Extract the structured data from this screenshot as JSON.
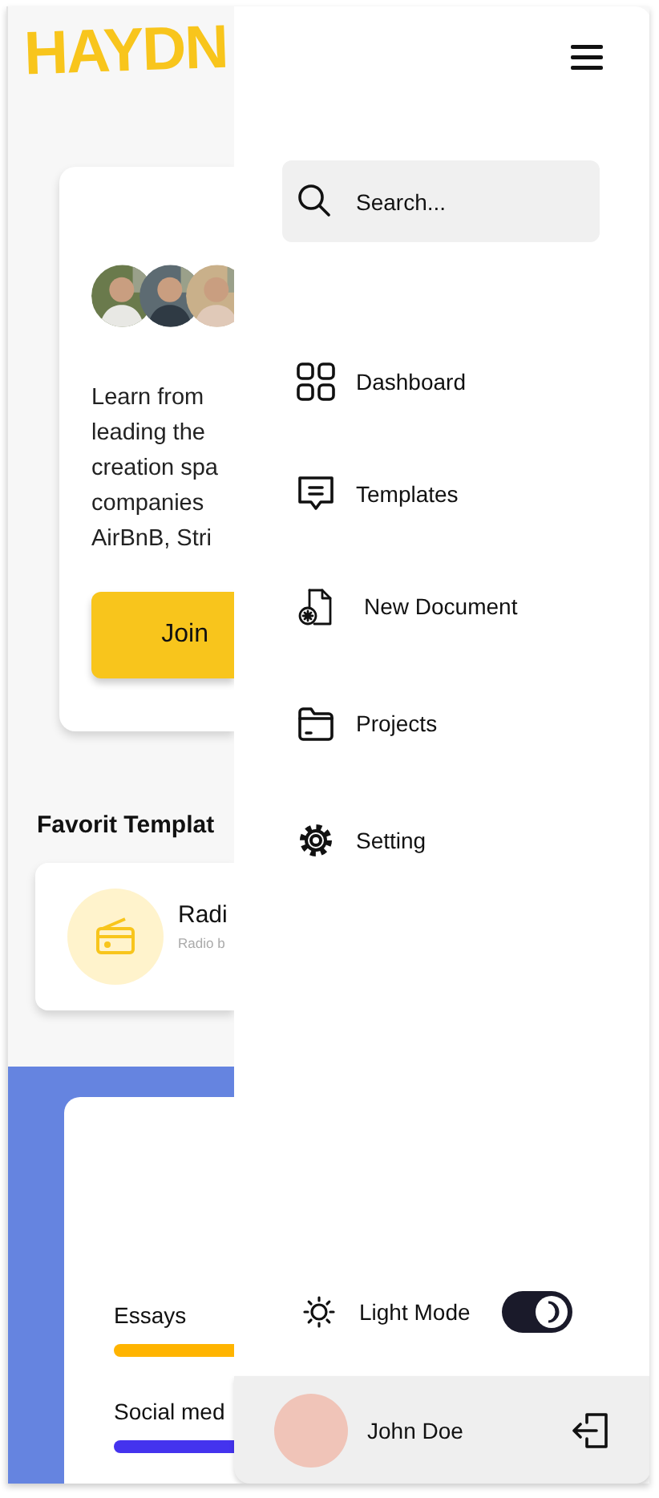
{
  "logo": "HAYDN",
  "promo": {
    "text_lines": [
      "Learn from",
      "leading the",
      "creation spa",
      "companies",
      "AirBnB, Stri"
    ],
    "button": "Join"
  },
  "favorites": {
    "title": "Favorit Templat",
    "items": [
      {
        "name": "Radi",
        "description": "Radio b"
      }
    ]
  },
  "stats": [
    {
      "label": "Essays",
      "color": "#ffb400"
    },
    {
      "label": "Social med",
      "color": "#4433ee"
    }
  ],
  "sidebar": {
    "search": {
      "placeholder": "Search..."
    },
    "items": [
      {
        "kind": "dashboard",
        "label": "Dashboard"
      },
      {
        "kind": "templates",
        "label": "Templates"
      },
      {
        "kind": "new-document",
        "label": "New Document"
      },
      {
        "kind": "projects",
        "label": "Projects"
      },
      {
        "kind": "settings",
        "label": "Setting"
      }
    ],
    "theme": {
      "label": "Light Mode",
      "on": true
    },
    "user": {
      "name": "John Doe"
    }
  }
}
